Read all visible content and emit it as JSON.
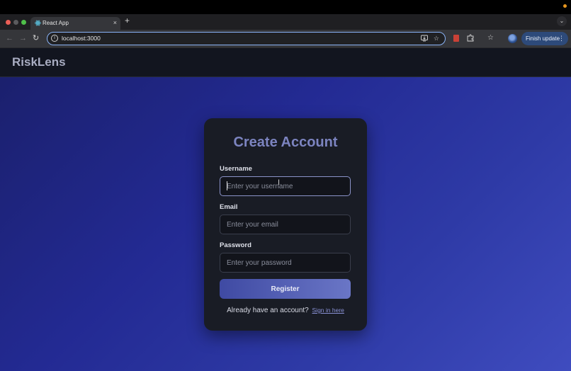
{
  "browser": {
    "tab_title": "React App",
    "tab_close": "×",
    "new_tab": "+",
    "tab_menu": "⌄",
    "url": "localhost:3000",
    "finish_update": "Finish update",
    "more_glyph": "⋮",
    "icons": [
      "back-arrow-icon",
      "forward-arrow-icon",
      "reload-icon",
      "site-info-icon",
      "install-app-icon",
      "star-icon",
      "extension-icon",
      "puzzle-icon",
      "bookmarks-icon",
      "profile-avatar"
    ]
  },
  "app": {
    "brand": "RiskLens",
    "form": {
      "title": "Create Account",
      "username_label": "Username",
      "username_placeholder": "Enter your username",
      "email_label": "Email",
      "email_placeholder": "Enter your email",
      "password_label": "Password",
      "password_placeholder": "Enter your password",
      "submit_label": "Register",
      "signin_prompt": "Already have an account?",
      "signin_link": "Sign in here"
    }
  },
  "colors": {
    "accent": "#8ab4f8",
    "title": "#7c84c0",
    "button_start": "#3f4aa3",
    "button_end": "#6a76c6",
    "card_bg": "#191c25"
  }
}
